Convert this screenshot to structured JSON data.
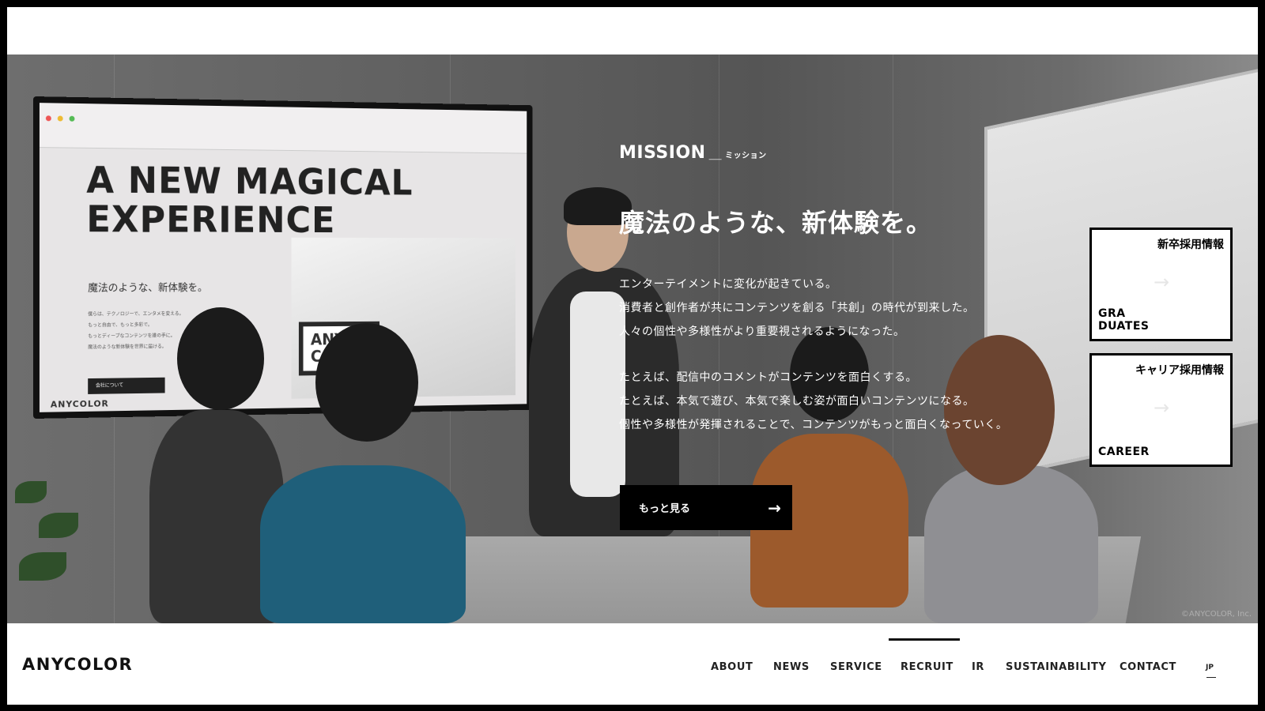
{
  "hero": {
    "tv": {
      "headline_line1": "A NEW MAGICAL",
      "headline_line2": "EXPERIENCE",
      "subtitle": "魔法のような、新体験を。",
      "body_lines": [
        "僕らは、テクノロジーで、エンタメを変える。",
        "もっと自由で、もっと多彩で。",
        "もっとディープなコンテンツを誰の手に。",
        "魔法のような新体験を世界に届ける。"
      ],
      "button": "会社について",
      "logo": "ANYCOLOR",
      "sign_text": "ANY CO"
    },
    "copyright": "©ANYCOLOR, Inc."
  },
  "mission": {
    "label": "MISSION",
    "separator": "＿",
    "kana": "ミッション",
    "headline": "魔法のような、新体験を。",
    "paragraph1": [
      "エンターテイメントに変化が起きている。",
      "消費者と創作者が共にコンテンツを創る「共創」の時代が到来した。",
      "人々の個性や多様性がより重要視されるようになった。"
    ],
    "paragraph2": [
      "たとえば、配信中のコメントがコンテンツを面白くする。",
      "たとえば、本気で遊び、本気で楽しむ姿が面白いコンテンツになる。",
      "個性や多様性が発揮されることで、コンテンツがもっと面白くなっていく。"
    ],
    "button_label": "もっと見る"
  },
  "side_cards": {
    "graduates": {
      "jp": "新卒採用情報",
      "en_line1": "GRA",
      "en_line2": "DUATES"
    },
    "career": {
      "jp": "キャリア採用情報",
      "en": "CAREER"
    }
  },
  "footer": {
    "logo": "ANYCOLOR",
    "nav": [
      "ABOUT",
      "NEWS",
      "SERVICE",
      "RECRUIT",
      "IR",
      "SUSTAINABILITY",
      "CONTACT"
    ],
    "active": "RECRUIT",
    "lang": "JP"
  },
  "colors": {
    "accent": "#000000",
    "text_on_photo": "#ffffff"
  }
}
